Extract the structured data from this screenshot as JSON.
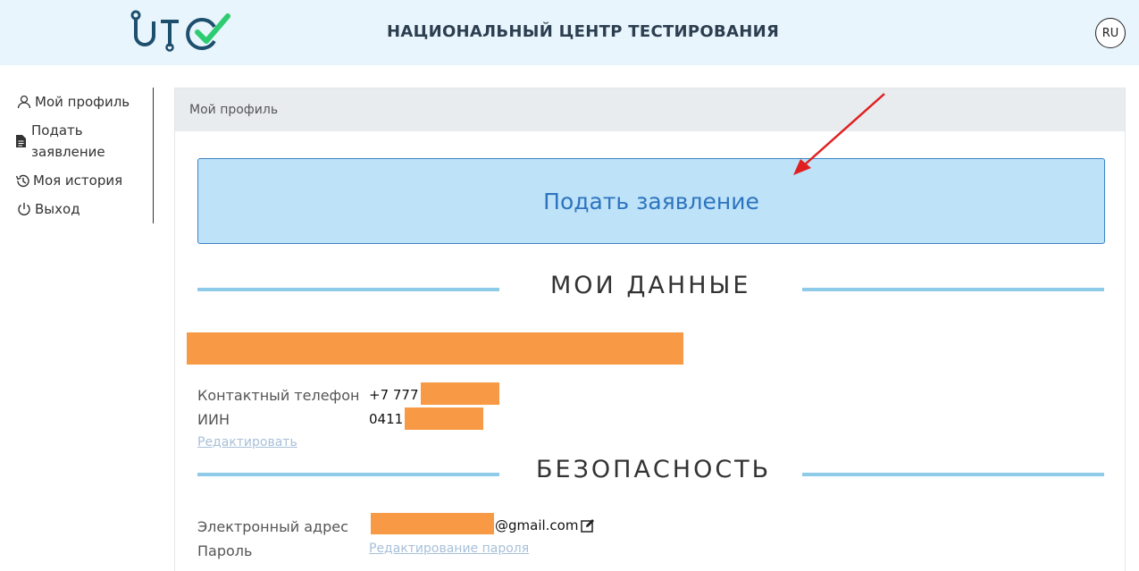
{
  "header": {
    "title": "НАЦИОНАЛЬНЫЙ ЦЕНТР ТЕСТИРОВАНИЯ",
    "lang": "RU",
    "colors": {
      "background": "#e8f5fc",
      "logo_blue": "#1e4f6e",
      "logo_green": "#2ecc71"
    }
  },
  "sidebar": {
    "items": [
      {
        "label": "Мой профиль",
        "icon": "user-icon"
      },
      {
        "label_line1": "Подать",
        "label_line2": "заявление",
        "icon": "document-icon"
      },
      {
        "label": "Моя история",
        "icon": "history-icon"
      },
      {
        "label": "Выход",
        "icon": "power-icon"
      }
    ]
  },
  "main": {
    "breadcrumb": "Мой профиль",
    "apply_button": "Подать заявление",
    "my_data": {
      "title": "МОИ ДАННЫЕ",
      "phone_label": "Контактный телефон",
      "phone_prefix": "+7 777",
      "iin_label": "ИИН",
      "iin_prefix": "0411",
      "edit_link": "Редактировать"
    },
    "security": {
      "title": "БЕЗОПАСНОСТЬ",
      "email_label": "Электронный адрес",
      "email_suffix": "@gmail.com",
      "password_label": "Пароль",
      "password_link": "Редактирование пароля"
    },
    "colors": {
      "accent": "#2d74c0",
      "button_bg": "#bee2f7",
      "rule": "#8ecbe8",
      "redaction": "#f89a45"
    }
  }
}
